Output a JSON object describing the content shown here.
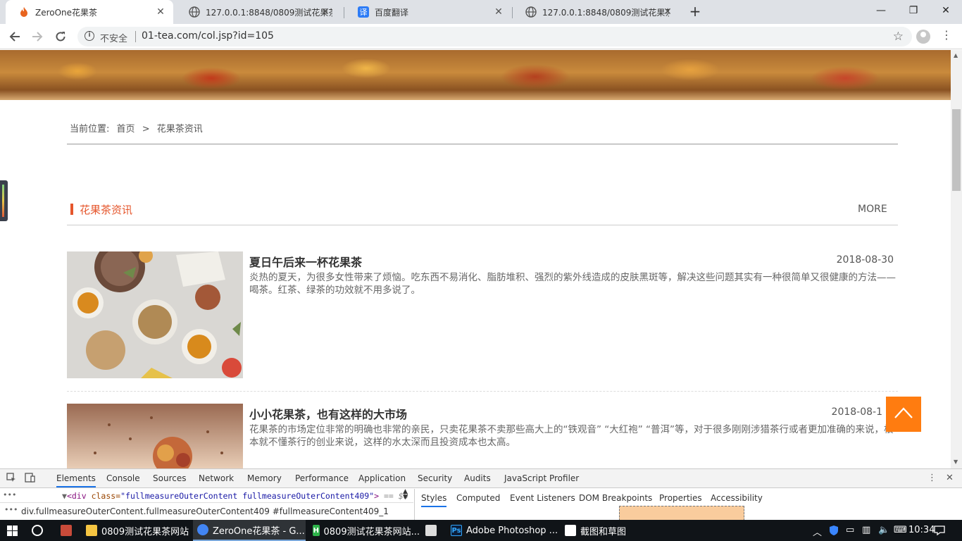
{
  "browser": {
    "tabs": [
      {
        "title": "ZeroOne花果茶",
        "icon": "flame-icon",
        "active": true
      },
      {
        "title": "127.0.0.1:8848/0809测试花果茶",
        "icon": "globe-icon",
        "active": false
      },
      {
        "title": "百度翻译",
        "icon": "baidu-translate-icon",
        "active": false
      },
      {
        "title": "127.0.0.1:8848/0809测试花果茶",
        "icon": "globe-icon",
        "active": false
      }
    ],
    "tab_close_glyph": "✕",
    "new_tab_glyph": "+",
    "window": {
      "minimize": "—",
      "restore": "❐",
      "close": "✕"
    },
    "security_label": "不安全",
    "url": "01-tea.com/col.jsp?id=105"
  },
  "page": {
    "breadcrumb": {
      "label": "当前位置:",
      "home": "首页",
      "separator": ">",
      "current": "花果茶资讯"
    },
    "section": {
      "title": "花果茶资讯",
      "more": "MORE"
    },
    "articles": [
      {
        "title": "夏日午后来一杯花果茶",
        "date": "2018-08-30",
        "summary": "炎热的夏天，为很多女性带来了烦恼。吃东西不易消化、脂肪堆积、强烈的紫外线造成的皮肤黑斑等，解决这些问题其实有一种很简单又很健康的方法——喝茶。红茶、绿茶的功效就不用多说了。"
      },
      {
        "title": "小小花果茶，也有这样的大市场",
        "date": "2018-08-1",
        "summary": "花果茶的市场定位非常的明确也非常的亲民，只卖花果茶不卖那些高大上的“铁观音” “大红袍” “普洱”等，对于很多刚刚涉猎茶行或者更加准确的来说，根本就不懂茶行的创业来说，这样的水太深而且投资成本也太高。"
      }
    ]
  },
  "devtools": {
    "tabs": [
      "Elements",
      "Console",
      "Sources",
      "Network",
      "Memory",
      "Performance",
      "Application",
      "Security",
      "Audits",
      "JavaScript Profiler"
    ],
    "active_tab": "Elements",
    "code": {
      "tag_open": "<div",
      "attr": " class=",
      "value": "\"fullmeasureOuterContent fullmeasureOuterContent409\"",
      "tag_close": ">",
      "suffix": " == $0"
    },
    "crumbs": "div.fullmeasureOuterContent.fullmeasureOuterContent409  #fullmeasureContent409_1",
    "subtabs": [
      "Styles",
      "Computed",
      "Event Listeners",
      "DOM Breakpoints",
      "Properties",
      "Accessibility"
    ],
    "active_subtab": "Styles"
  },
  "taskbar": {
    "apps": [
      {
        "label": "0809测试花果茶网站",
        "icon": "folder-icon",
        "color": "#f5c542"
      },
      {
        "label": "ZeroOne花果茶 - G...",
        "icon": "chrome-icon",
        "color": "#4285f4",
        "active": true
      },
      {
        "label": "0809测试花果茶网站...",
        "icon": "hbuilder-icon",
        "color": "#2db34a"
      },
      {
        "label": "Adobe Photoshop ...",
        "icon": "photoshop-icon",
        "color": "#31a8ff"
      },
      {
        "label": "截图和草图",
        "icon": "snip-icon",
        "color": "#ffffff"
      }
    ],
    "clock": "10:34"
  },
  "colors": {
    "accent": "#e5562c",
    "back_to_top": "#ff7c10",
    "devtools_active": "#1a73e8"
  }
}
